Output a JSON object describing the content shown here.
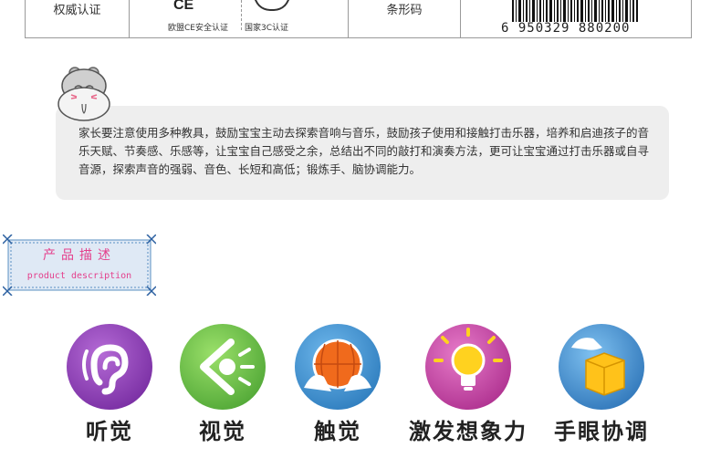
{
  "spec": {
    "cert_label": "权威认证",
    "ce_mark": "CE",
    "ce_caption": "欧盟CE安全认证",
    "ccc_caption": "国家3C认证",
    "barcode_label": "条形码",
    "barcode_number": "6 950329 880200"
  },
  "notice": {
    "text": "家长要注意使用多种教具，鼓励宝宝主动去探索音响与音乐，鼓励孩子使用和接触打击乐器，培养和启迪孩子的音乐天赋、节奏感、乐感等，让宝宝自己感受之余，总结出不同的敲打和演奏方法，更可让宝宝通过打击乐器或自寻音源，探索声音的强弱、音色、长短和高低；锻炼手、脑协调能力。"
  },
  "tag": {
    "title": "产品描述",
    "subtitle": "product description"
  },
  "features": [
    {
      "label": "听觉",
      "icon": "ear-icon",
      "color": "#7b2fa8"
    },
    {
      "label": "视觉",
      "icon": "eye-icon",
      "color": "#5fae3a"
    },
    {
      "label": "触觉",
      "icon": "hands-ball-icon",
      "color": "#2f86c9"
    },
    {
      "label": "激发想象力",
      "icon": "lightbulb-icon",
      "color": "#c2359a"
    },
    {
      "label": "手眼协调",
      "icon": "hand-box-icon",
      "color": "#2a78c4"
    }
  ],
  "colors": {
    "tag_pink": "#e43f8c",
    "tag_bg": "#dfe9f5",
    "bubble_bg": "#eeeeee"
  }
}
